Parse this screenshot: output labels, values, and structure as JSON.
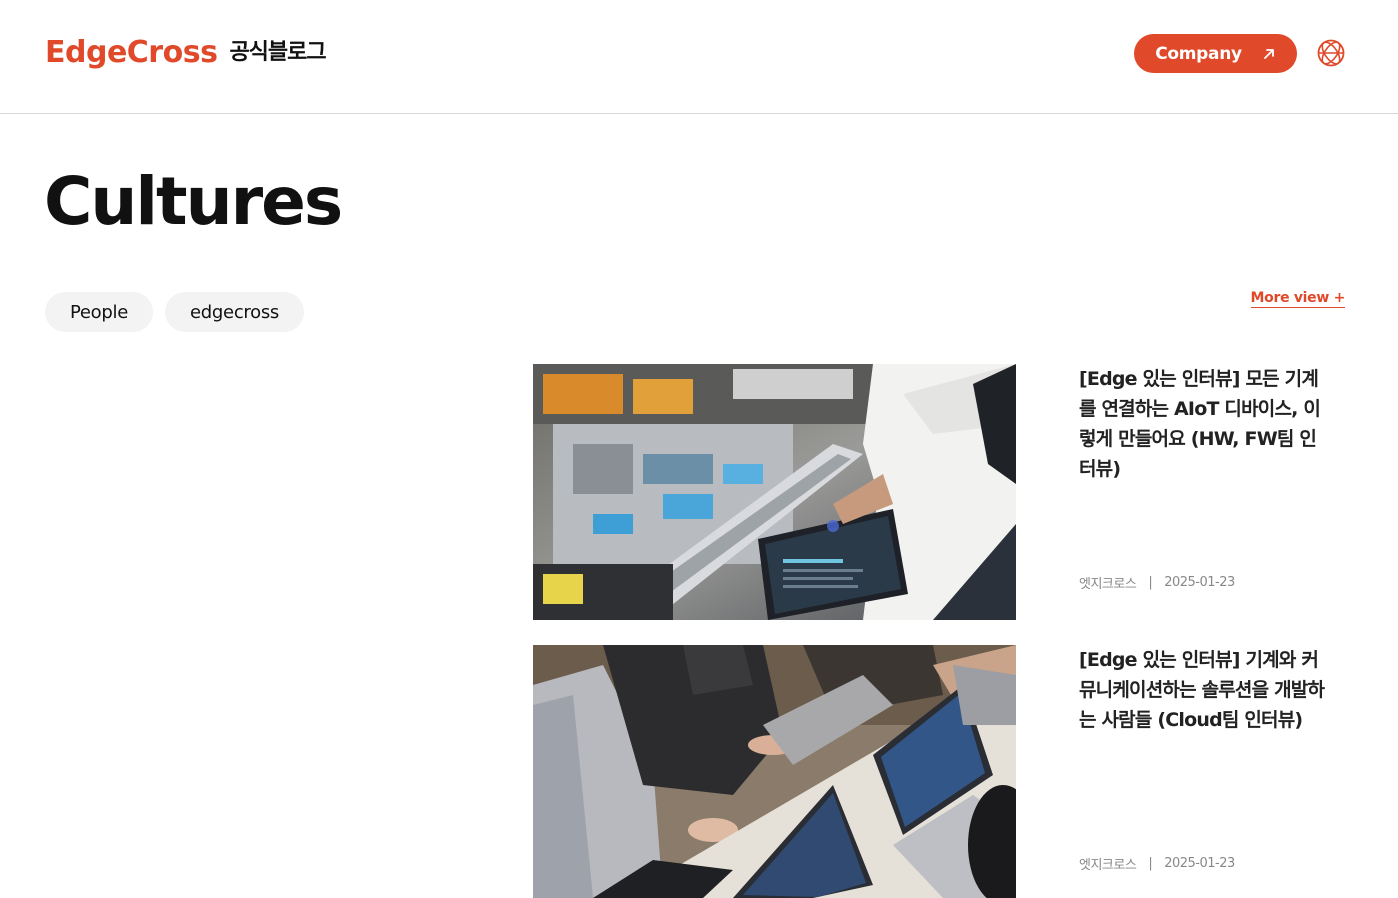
{
  "header": {
    "brand": "EdgeCross",
    "brand_sub": "공식블로그",
    "company_label": "Company",
    "accent_color": "#e0492a"
  },
  "page": {
    "title": "Cultures"
  },
  "tags": [
    "People",
    "edgecross"
  ],
  "more_view": "More view +",
  "articles": [
    {
      "title": "[Edge 있는 인터뷰] 모든 기계를 연결하는 AIoT 디바이스, 이렇게 만들어요 (HW, FW팀 인터뷰)",
      "author": "엣지크로스",
      "date": "2025-01-23",
      "image": "factory-automation-line-photo"
    },
    {
      "title": "[Edge 있는 인터뷰] 기계와 커뮤니케이션하는 솔루션을 개발하는 사람들 (Cloud팀 인터뷰)",
      "author": "엣지크로스",
      "date": "2025-01-23",
      "image": "team-laptops-photo"
    }
  ]
}
